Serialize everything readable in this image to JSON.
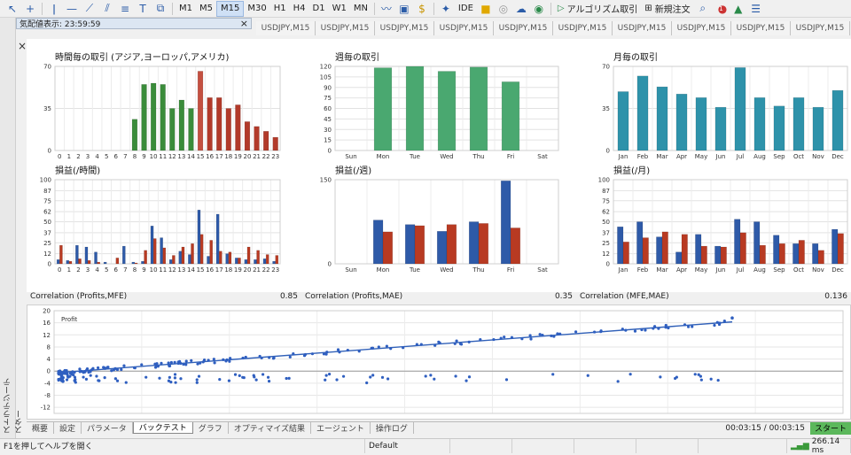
{
  "toolbar": {
    "timeframes": [
      "M1",
      "M5",
      "M15",
      "M30",
      "H1",
      "H4",
      "D1",
      "W1",
      "MN"
    ],
    "active_tf": "M15",
    "ide": "IDE",
    "algo": "アルゴリズム取引",
    "neworder": "新規注文",
    "badge": "1"
  },
  "quote": {
    "label": "気配値表示: 23:59:59"
  },
  "chart_tab_label": "USDJPY,M15",
  "chart_tab_count": 10,
  "side_label": "ストラテジーテスター",
  "correlations": [
    {
      "label": "Correlation (Profits,MFE)",
      "value": "0.85"
    },
    {
      "label": "Correlation (Profits,MAE)",
      "value": "0.35"
    },
    {
      "label": "Correlation (MFE,MAE)",
      "value": "0.136"
    }
  ],
  "bottom_tabs": [
    "概要",
    "設定",
    "パラメータ",
    "バックテスト",
    "グラフ",
    "オプティマイズ結果",
    "エージェント",
    "操作ログ"
  ],
  "active_bottom_tab": "バックテスト",
  "timer": "00:03:15 / 00:03:15",
  "start_label": "スタート",
  "status": {
    "help": "F1を押してヘルプを開く",
    "profile": "Default",
    "ping": "266.14 ms"
  },
  "chart_data": [
    {
      "type": "bar",
      "title": "時間毎の取引 (アジア,ヨーロッパ,アメリカ)",
      "categories": [
        "0",
        "1",
        "2",
        "3",
        "4",
        "5",
        "6",
        "7",
        "8",
        "9",
        "10",
        "11",
        "12",
        "13",
        "14",
        "15",
        "16",
        "17",
        "18",
        "19",
        "20",
        "21",
        "22",
        "23"
      ],
      "ylim": [
        0,
        70
      ],
      "yticks": [
        "0",
        "35",
        "70"
      ],
      "series": [
        {
          "values": [
            0,
            0,
            0,
            0,
            0,
            0,
            0,
            0,
            26,
            55,
            56,
            55,
            35,
            42,
            35,
            66,
            44,
            44,
            35,
            38,
            24,
            20,
            16,
            11
          ]
        }
      ],
      "colors": [
        "#3a8c3a",
        "#3a8c3a",
        "#3a8c3a",
        "#3a8c3a",
        "#3a8c3a",
        "#3a8c3a",
        "#3a8c3a",
        "#3a8c3a",
        "#3a8c3a",
        "#3a8c3a",
        "#3a8c3a",
        "#3a8c3a",
        "#3a8c3a",
        "#3a8c3a",
        "#3a8c3a",
        "#c45040",
        "#b23a2a",
        "#b23a2a",
        "#b23a2a",
        "#b23a2a",
        "#b23a2a",
        "#b23a2a",
        "#b23a2a",
        "#b23a2a"
      ]
    },
    {
      "type": "bar",
      "title": "週毎の取引",
      "categories": [
        "Sun",
        "Mon",
        "Tue",
        "Wed",
        "Thu",
        "Fri",
        "Sat"
      ],
      "ylim": [
        0,
        120
      ],
      "yticks": [
        "0",
        "15",
        "30",
        "45",
        "60",
        "75",
        "90",
        "105",
        "120"
      ],
      "series": [
        {
          "values": [
            0,
            118,
            120,
            113,
            119,
            98,
            0
          ]
        }
      ],
      "color": "#4aa870"
    },
    {
      "type": "bar",
      "title": "月毎の取引",
      "categories": [
        "Jan",
        "Feb",
        "Mar",
        "Apr",
        "May",
        "Jun",
        "Jul",
        "Aug",
        "Sep",
        "Oct",
        "Nov",
        "Dec"
      ],
      "ylim": [
        0,
        70
      ],
      "yticks": [
        "0",
        "35",
        "70"
      ],
      "series": [
        {
          "values": [
            49,
            62,
            53,
            47,
            44,
            36,
            69,
            44,
            37,
            44,
            36,
            50
          ]
        }
      ],
      "color": "#2e92aa"
    },
    {
      "type": "bar",
      "title": "損益(/時間)",
      "categories": [
        "0",
        "1",
        "2",
        "3",
        "4",
        "5",
        "6",
        "7",
        "8",
        "9",
        "10",
        "11",
        "12",
        "13",
        "14",
        "15",
        "16",
        "17",
        "18",
        "19",
        "20",
        "21",
        "22",
        "23"
      ],
      "ylim": [
        0,
        100
      ],
      "yticks": [
        "0",
        "12",
        "25",
        "37",
        "50",
        "62",
        "75",
        "87",
        "100"
      ],
      "series": [
        {
          "values": [
            5,
            4,
            22,
            20,
            14,
            2,
            0,
            21,
            2,
            3,
            45,
            31,
            5,
            15,
            11,
            64,
            9,
            59,
            12,
            7,
            5,
            5,
            6,
            3
          ]
        },
        {
          "values": [
            22,
            3,
            6,
            4,
            2,
            0,
            7,
            0,
            1,
            16,
            30,
            19,
            10,
            20,
            24,
            35,
            28,
            15,
            14,
            7,
            20,
            16,
            11,
            10
          ]
        }
      ],
      "colors": [
        "#2e5aa8",
        "#b83a22"
      ]
    },
    {
      "type": "bar",
      "title": "損益(/週)",
      "categories": [
        "Sun",
        "Mon",
        "Tue",
        "Wed",
        "Thu",
        "Fri",
        "Sat"
      ],
      "ylim": [
        0,
        150
      ],
      "yticks": [
        "0",
        "150"
      ],
      "series": [
        {
          "values": [
            0,
            78,
            70,
            58,
            75,
            148,
            0
          ]
        },
        {
          "values": [
            0,
            57,
            68,
            70,
            72,
            64,
            0
          ]
        }
      ],
      "colors": [
        "#2e5aa8",
        "#b83a22"
      ]
    },
    {
      "type": "bar",
      "title": "損益(/月)",
      "categories": [
        "Jan",
        "Feb",
        "Mar",
        "Apr",
        "May",
        "Jun",
        "Jul",
        "Aug",
        "Sep",
        "Oct",
        "Nov",
        "Dec"
      ],
      "ylim": [
        0,
        100
      ],
      "yticks": [
        "0",
        "12",
        "25",
        "37",
        "50",
        "62",
        "75",
        "87",
        "100"
      ],
      "series": [
        {
          "values": [
            44,
            50,
            32,
            14,
            35,
            21,
            53,
            50,
            34,
            24,
            24,
            41
          ]
        },
        {
          "values": [
            26,
            31,
            38,
            35,
            21,
            20,
            37,
            22,
            24,
            28,
            16,
            36
          ]
        }
      ],
      "colors": [
        "#2e5aa8",
        "#b83a22"
      ]
    },
    {
      "type": "scatter",
      "series_label": "Profit",
      "ylim": [
        -14,
        20
      ],
      "yticks": [
        "-12",
        "-8",
        "-4",
        "0",
        "4",
        "8",
        "12",
        "16",
        "20"
      ],
      "trend": [
        [
          0,
          -0.5
        ],
        [
          1,
          16.3
        ]
      ]
    }
  ]
}
